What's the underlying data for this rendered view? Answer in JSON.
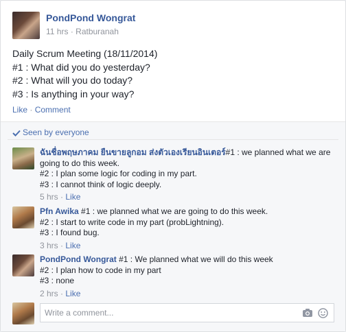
{
  "post": {
    "author": "PondPond Wongrat",
    "time": "11 hrs",
    "location": "Ratburanah",
    "lines": [
      "Daily Scrum Meeting (18/11/2014)",
      "#1 : What did you do yesterday?",
      "#2 : What will you do today?",
      "#3 : Is anything in your way?"
    ],
    "like_label": "Like",
    "comment_label": "Comment",
    "separator": "·"
  },
  "seen": {
    "label": "Seen by everyone",
    "icon": "checkmark-icon"
  },
  "comments": [
    {
      "author": "ฉันชื่อพฤษภาคม ยืนขายลูกอม ส่งตัวเองเรียนอินเตอร์",
      "first": "#1 : we planned what we are going to do this week.",
      "lines": [
        "#2 : I plan some logic for coding in my part.",
        "#3 : I cannot think of logic deeply."
      ],
      "time": "5 hrs",
      "like": "Like"
    },
    {
      "author": "Pfn Awika",
      "first": "#1 : we planned what we are going to do this week.",
      "lines": [
        "#2 : I start to write code in my part (probLightning).",
        "#3 : I found bug."
      ],
      "time": "3 hrs",
      "like": "Like"
    },
    {
      "author": "PondPond Wongrat",
      "first": "#1 : We planned what we will do this week",
      "lines": [
        "#2 : I plan how to code in my part",
        "#3 : none"
      ],
      "time": "2 hrs",
      "like": "Like"
    }
  ],
  "composer": {
    "placeholder": "Write a comment...",
    "icons": [
      "camera-icon",
      "sticker-icon"
    ]
  },
  "colors": {
    "link": "#365899",
    "meta": "#90949c",
    "text": "#1d2129",
    "background": "#f6f7f9"
  }
}
